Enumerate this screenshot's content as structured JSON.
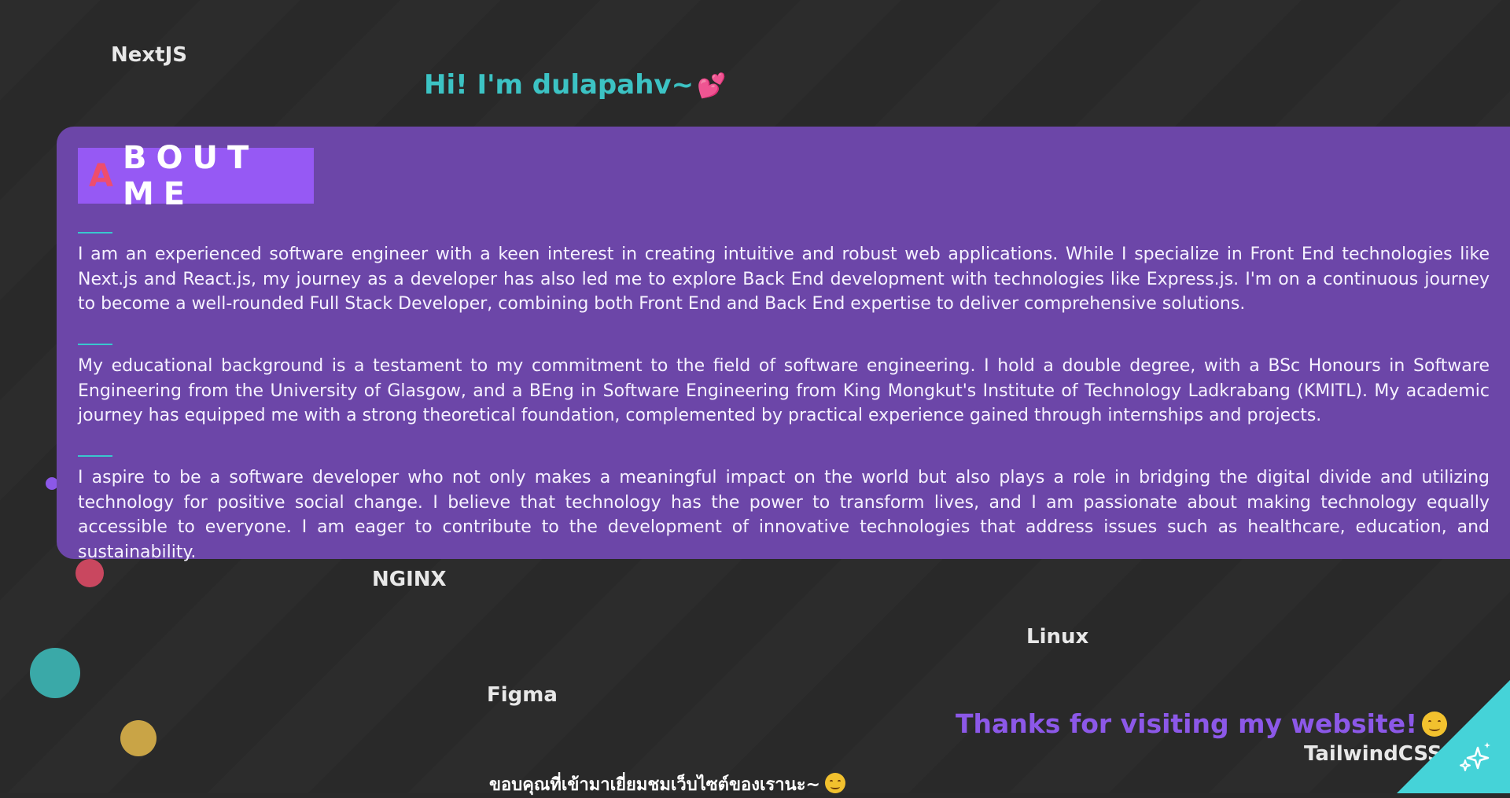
{
  "colors": {
    "background": "#2a2a2a",
    "card": "#6c46a8",
    "title_box": "#9659f4",
    "title_first_letter": "#ee4d6d",
    "accent_teal": "#3cc3c4",
    "accent_purple": "#8c58e8",
    "divider": "#39c7ce",
    "dot_pink": "#c9475f",
    "dot_teal": "#3aa9a8",
    "dot_gold": "#c9a446",
    "dot_purple": "#8c58e8"
  },
  "greeting": {
    "text": "Hi! I'm dulapahv~",
    "emoji": "💕"
  },
  "about": {
    "title_first": "A",
    "title_rest": "BOUT ME",
    "paragraphs": [
      "I am an experienced software engineer with a keen interest in creating intuitive and robust web applications. While I specialize in Front End technologies like Next.js and React.js, my journey as a developer has also led me to explore Back End development with technologies like Express.js. I'm on a continuous journey to become a well-rounded Full Stack Developer, combining both Front End and Back End expertise to deliver comprehensive solutions.",
      "My educational background is a testament to my commitment to the field of software engineering. I hold a double degree, with a BSc Honours in Software Engineering from the University of Glasgow, and a BEng in Software Engineering from King Mongkut's Institute of Technology Ladkrabang (KMITL). My academic journey has equipped me with a strong theoretical foundation, complemented by practical experience gained through internships and projects.",
      "I aspire to be a software developer who not only makes a meaningful impact on the world but also plays a role in bridging the digital divide and utilizing technology for positive social change. I believe that technology has the power to transform lives, and I am passionate about making technology equally accessible to everyone. I am eager to contribute to the development of innovative technologies that address issues such as healthcare, education, and sustainability."
    ]
  },
  "tech_labels": {
    "nextjs": "NextJS",
    "nginx": "NGINX",
    "linux": "Linux",
    "figma": "Figma",
    "tailwind": "TailwindCSS"
  },
  "thanks": {
    "text": "Thanks for visiting my website!",
    "emoji": "smiling-face-icon"
  },
  "thai_thanks": {
    "text": "ขอบคุณที่เข้ามาเยี่ยมชมเว็บไซต์ของเรานะ~",
    "emoji": "smiling-face-icon"
  },
  "corner_button": {
    "icon": "sparkles-icon"
  }
}
